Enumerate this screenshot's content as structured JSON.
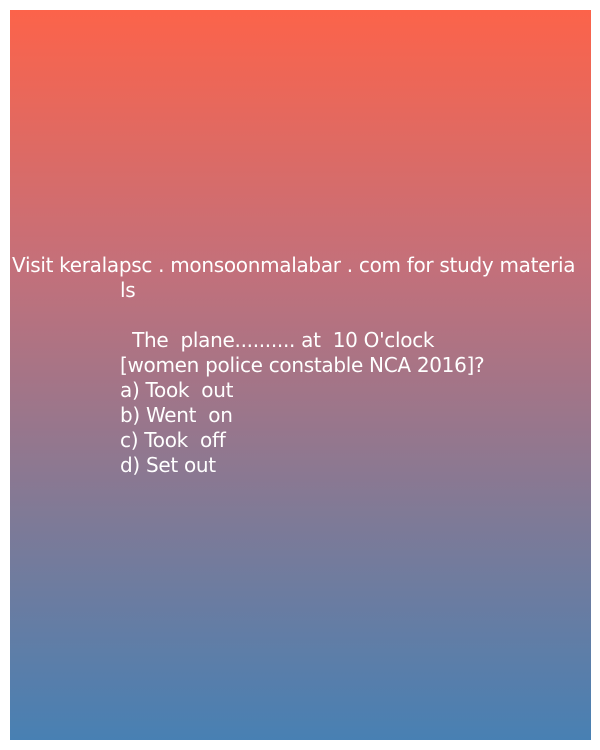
{
  "promo": {
    "line1": "Visit keralapsc . monsoonmalabar . com for study materia",
    "line2": "ls"
  },
  "question": {
    "text": "  The  plane.......... at  10 O'clock",
    "source": "[women police constable NCA 2016]?"
  },
  "options": [
    "a) Took  out",
    "b) Went  on",
    "c) Took  off",
    "d) Set out"
  ]
}
